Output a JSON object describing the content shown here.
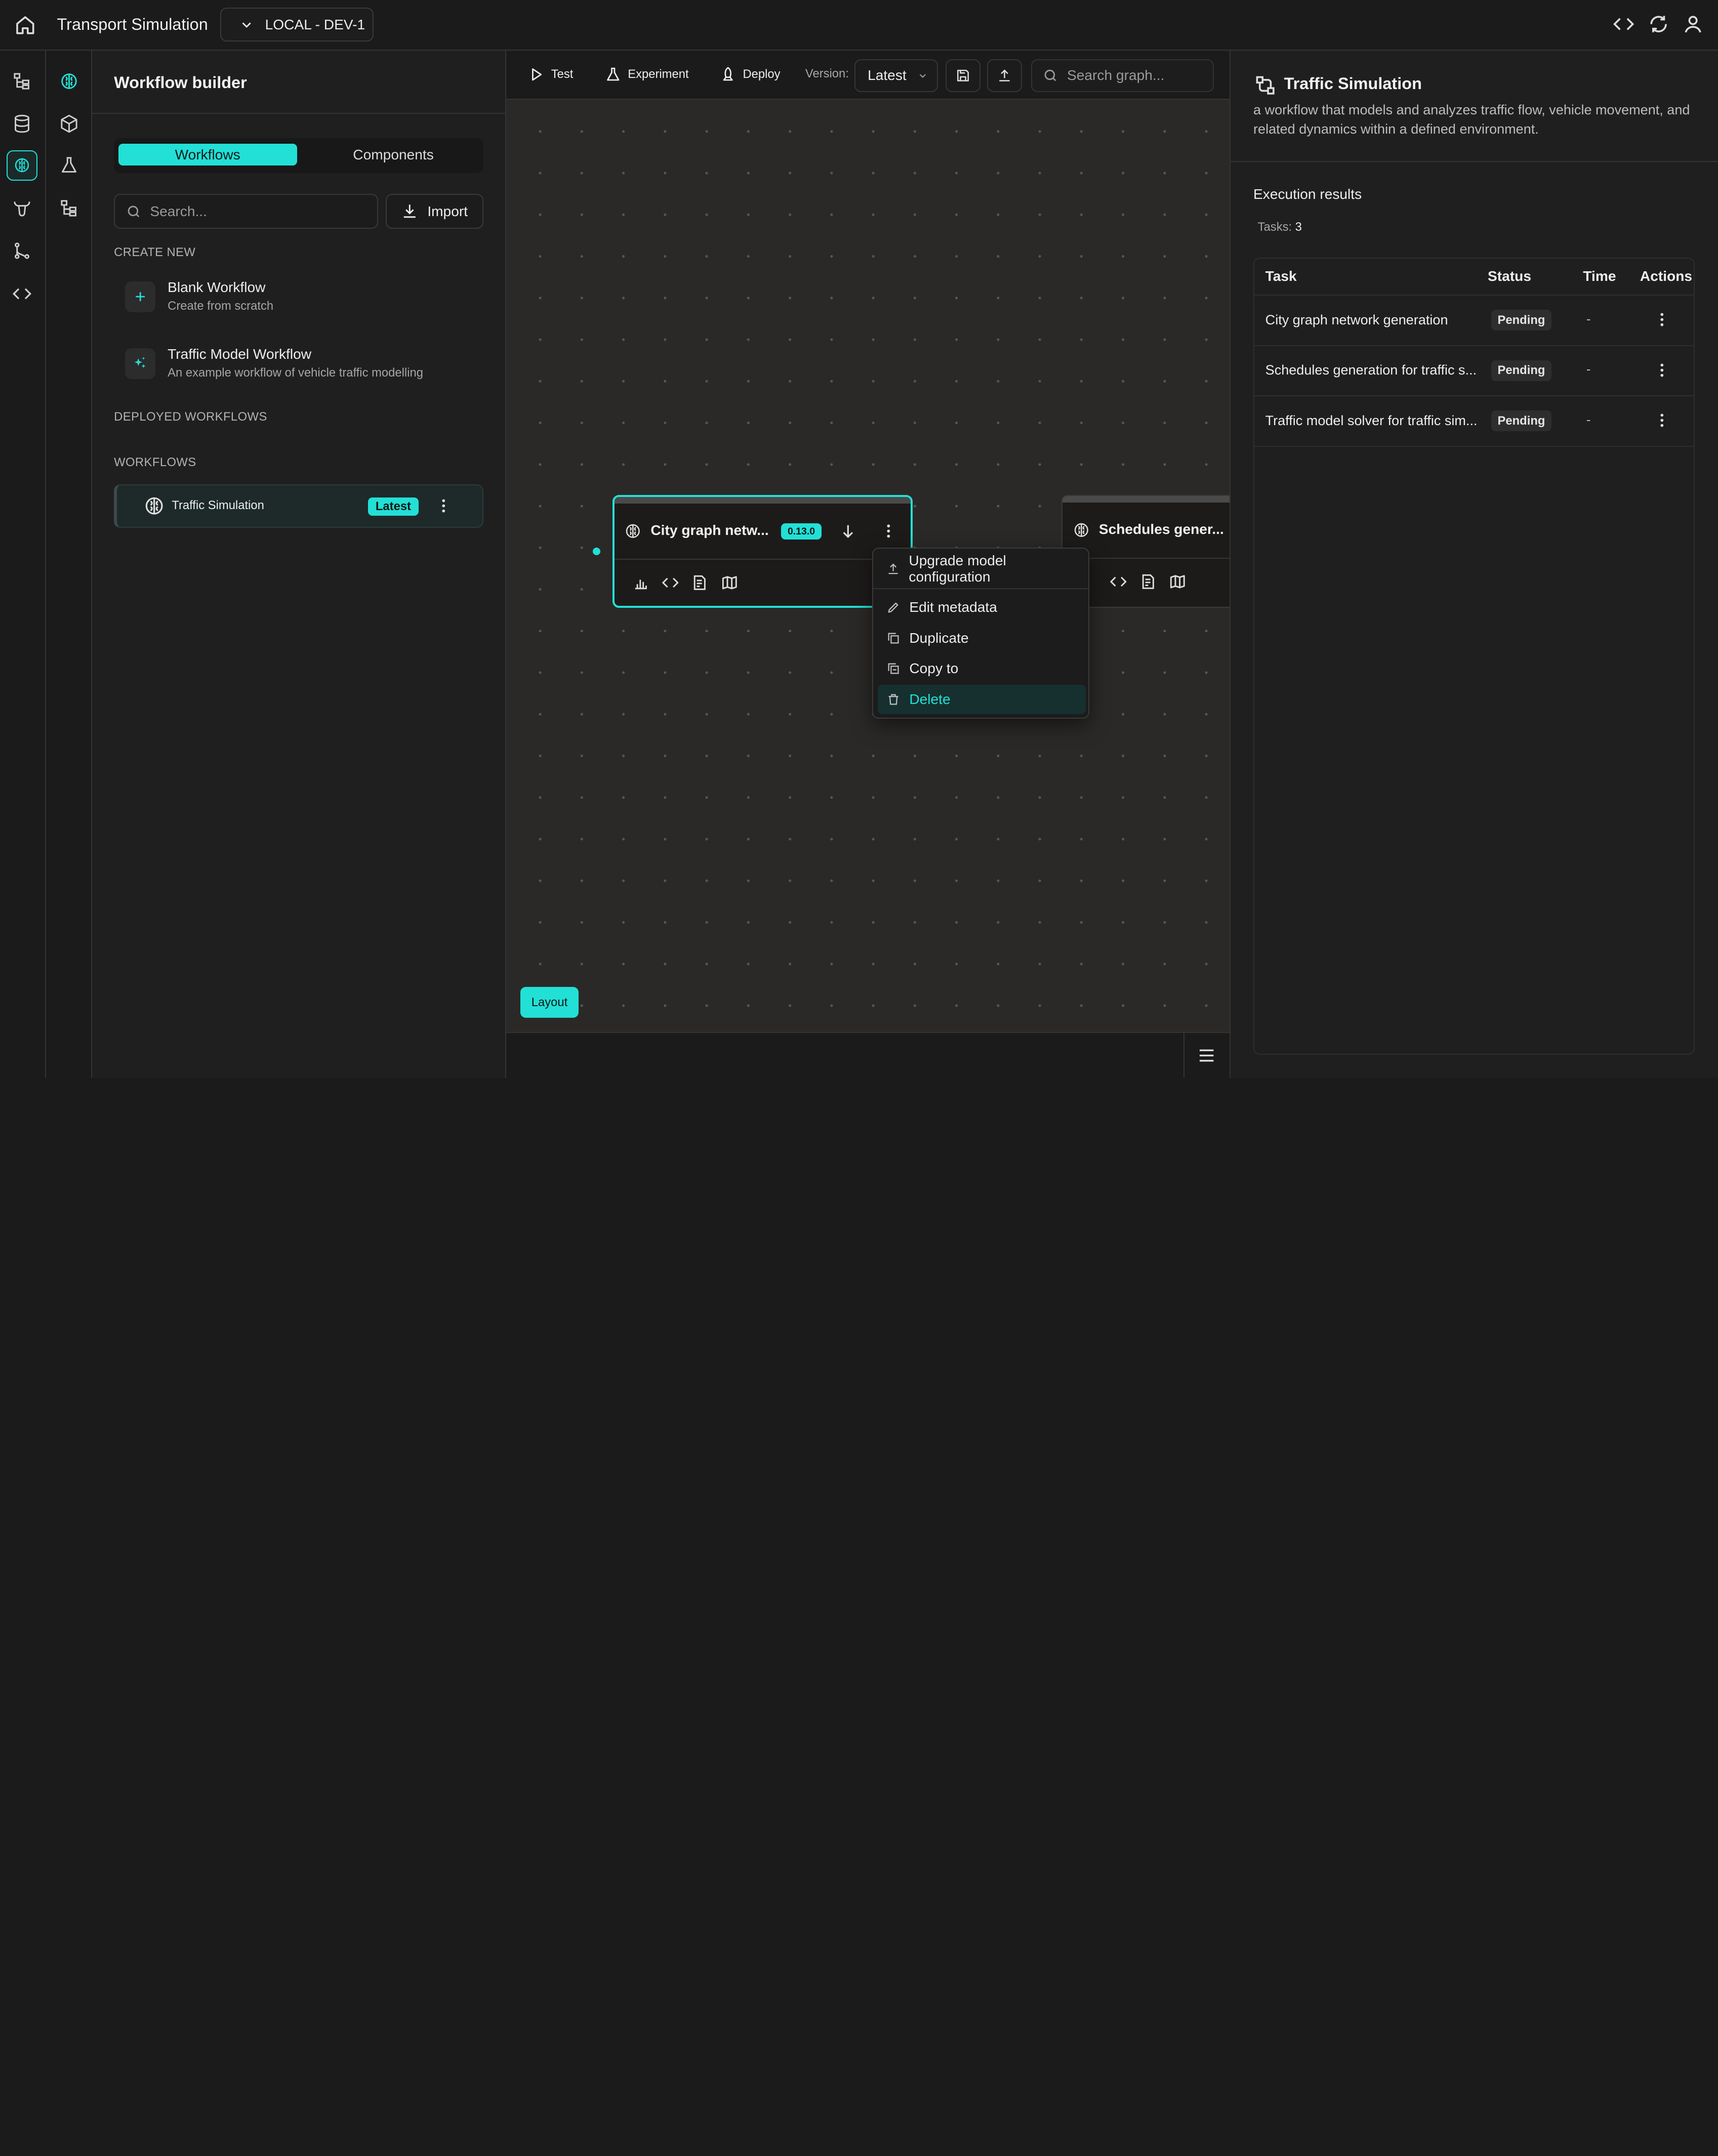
{
  "topbar": {
    "app_title": "Transport Simulation",
    "environment": "LOCAL - DEV-1",
    "icons": [
      "home-icon",
      "code-icon",
      "refresh-icon",
      "user-icon"
    ]
  },
  "rail": {
    "icons": [
      "hierarchy-icon",
      "database-icon",
      "brain-icon",
      "flask-icon",
      "bull-icon",
      "git-branch-icon",
      "code-icon"
    ],
    "secondary_icons": [
      "brain-icon",
      "cube-icon",
      "flask-icon",
      "hierarchy-icon"
    ]
  },
  "left_panel": {
    "title": "Workflow builder",
    "tabs": [
      "Workflows",
      "Components"
    ],
    "search_placeholder": "Search...",
    "import_label": "Import",
    "create_new_label": "CREATE NEW",
    "create_items": [
      {
        "title": "Blank Workflow",
        "subtitle": "Create from scratch",
        "icon": "plus-icon"
      },
      {
        "title": "Traffic Model Workflow",
        "subtitle": "An example workflow of vehicle traffic modelling",
        "icon": "sparkles-icon"
      }
    ],
    "deployed_label": "DEPLOYED WORKFLOWS",
    "workflows_label": "WORKFLOWS",
    "workflow_item": {
      "name": "Traffic Simulation",
      "badge": "Latest"
    }
  },
  "toolbar": {
    "test": "Test",
    "experiment": "Experiment",
    "deploy": "Deploy",
    "version_label": "Version:",
    "version_value": "Latest",
    "search_placeholder": "Search graph..."
  },
  "canvas": {
    "node1": {
      "title": "City graph netw...",
      "version": "0.13.0"
    },
    "node2": {
      "title": "Schedules gener..."
    },
    "context_menu": [
      "Upgrade model configuration",
      "Edit metadata",
      "Duplicate",
      "Copy to",
      "Delete"
    ],
    "layout_label": "Layout"
  },
  "right_panel": {
    "title": "Traffic Simulation",
    "description": "a workflow that models and analyzes traffic flow, vehicle movement, and related dynamics within a defined environment.",
    "exec_title": "Execution results",
    "tasks_label": "Tasks:",
    "tasks_count": "3",
    "columns": [
      "Task",
      "Status",
      "Time",
      "Actions"
    ],
    "rows": [
      {
        "task": "City graph network generation",
        "status": "Pending",
        "time": "-"
      },
      {
        "task": "Schedules generation for traffic s...",
        "status": "Pending",
        "time": "-"
      },
      {
        "task": "Traffic model solver for traffic sim...",
        "status": "Pending",
        "time": "-"
      }
    ]
  },
  "colors": {
    "accent": "#22e0d6",
    "background": "#1b1b1b",
    "canvas": "#2b2927"
  }
}
